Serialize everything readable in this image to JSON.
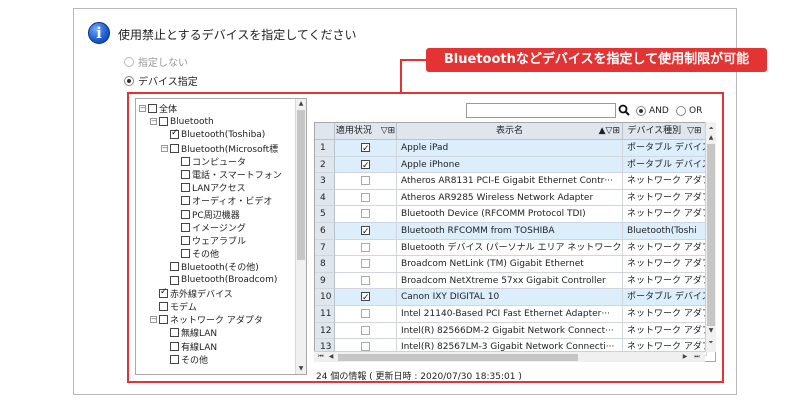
{
  "header": {
    "title": "使用禁止とするデバイスを指定してください",
    "info_icon_glyph": "i"
  },
  "options": {
    "no_specify": "指定しない",
    "device_specify": "デバイス指定"
  },
  "callout": {
    "text": "Bluetoothなどデバイスを指定して使用制限が可能",
    "color": "#e33333"
  },
  "tree": {
    "items": [
      {
        "label": "全体",
        "checked": false,
        "expander": "−",
        "level": 0
      },
      {
        "label": "Bluetooth",
        "checked": false,
        "expander": "−",
        "level": 1
      },
      {
        "label": "Bluetooth(Toshiba)",
        "checked": true,
        "expander": "",
        "level": 2
      },
      {
        "label": "Bluetooth(Microsoft標",
        "checked": false,
        "expander": "−",
        "level": 2
      },
      {
        "label": "コンピュータ",
        "checked": false,
        "expander": "",
        "level": 3
      },
      {
        "label": "電話・スマートフォン",
        "checked": false,
        "expander": "",
        "level": 3
      },
      {
        "label": "LANアクセス",
        "checked": false,
        "expander": "",
        "level": 3
      },
      {
        "label": "オーディオ・ビデオ",
        "checked": false,
        "expander": "",
        "level": 3
      },
      {
        "label": "PC周辺機器",
        "checked": false,
        "expander": "",
        "level": 3
      },
      {
        "label": "イメージング",
        "checked": false,
        "expander": "",
        "level": 3
      },
      {
        "label": "ウェアラブル",
        "checked": false,
        "expander": "",
        "level": 3
      },
      {
        "label": "その他",
        "checked": false,
        "expander": "",
        "level": 3
      },
      {
        "label": "Bluetooth(その他)",
        "checked": false,
        "expander": "",
        "level": 2
      },
      {
        "label": "Bluetooth(Broadcom)",
        "checked": false,
        "expander": "",
        "level": 2
      },
      {
        "label": "赤外線デバイス",
        "checked": true,
        "expander": "",
        "level": 1
      },
      {
        "label": "モデム",
        "checked": false,
        "expander": "",
        "level": 1
      },
      {
        "label": "ネットワーク アダプタ",
        "checked": false,
        "expander": "−",
        "level": 1
      },
      {
        "label": "無線LAN",
        "checked": false,
        "expander": "",
        "level": 2
      },
      {
        "label": "有線LAN",
        "checked": false,
        "expander": "",
        "level": 2
      },
      {
        "label": "その他",
        "checked": false,
        "expander": "",
        "level": 2
      }
    ]
  },
  "search": {
    "value": "",
    "and_label": "AND",
    "or_label": "OR"
  },
  "table": {
    "columns": [
      "",
      "適用状況",
      "表示名",
      "デバイス種別"
    ],
    "rows": [
      {
        "no": "1",
        "checked": true,
        "name": "Apple iPad",
        "type": "ポータブル デバイス"
      },
      {
        "no": "2",
        "checked": true,
        "name": "Apple iPhone",
        "type": "ポータブル デバイス"
      },
      {
        "no": "3",
        "checked": false,
        "name": "Atheros AR8131 PCI-E Gigabit Ethernet Contr···",
        "type": "ネットワーク アダプタ"
      },
      {
        "no": "4",
        "checked": false,
        "name": "Atheros AR9285 Wireless Network Adapter",
        "type": "ネットワーク アダプタ"
      },
      {
        "no": "5",
        "checked": false,
        "name": "Bluetooth Device (RFCOMM Protocol TDI)",
        "type": "ネットワーク アダプタ"
      },
      {
        "no": "6",
        "checked": true,
        "name": "Bluetooth RFCOMM from TOSHIBA",
        "type": "Bluetooth(Toshi"
      },
      {
        "no": "7",
        "checked": false,
        "name": "Bluetooth デバイス (パーソナル エリア ネットワーク)",
        "type": "ネットワーク アダプタ"
      },
      {
        "no": "8",
        "checked": false,
        "name": "Broadcom NetLink (TM) Gigabit Ethernet",
        "type": "ネットワーク アダプタ"
      },
      {
        "no": "9",
        "checked": false,
        "name": "Broadcom NetXtreme 57xx Gigabit Controller",
        "type": "ネットワーク アダプタ"
      },
      {
        "no": "10",
        "checked": true,
        "name": "Canon IXY DIGITAL 10",
        "type": "ポータブル デバイス"
      },
      {
        "no": "11",
        "checked": false,
        "name": "Intel 21140-Based PCI Fast Ethernet Adapter···",
        "type": "ネットワーク アダプタ"
      },
      {
        "no": "12",
        "checked": false,
        "name": "Intel(R) 82566DM-2 Gigabit Network Connect···",
        "type": "ネットワーク アダプタ"
      },
      {
        "no": "13",
        "checked": false,
        "name": "Intel(R) 82567LM-3 Gigabit Network Connecti···",
        "type": "ネットワーク アダプタ"
      }
    ]
  },
  "status": {
    "text": "24 個の情報 ( 更新日時 : 2020/07/30 18:35:01 )"
  }
}
